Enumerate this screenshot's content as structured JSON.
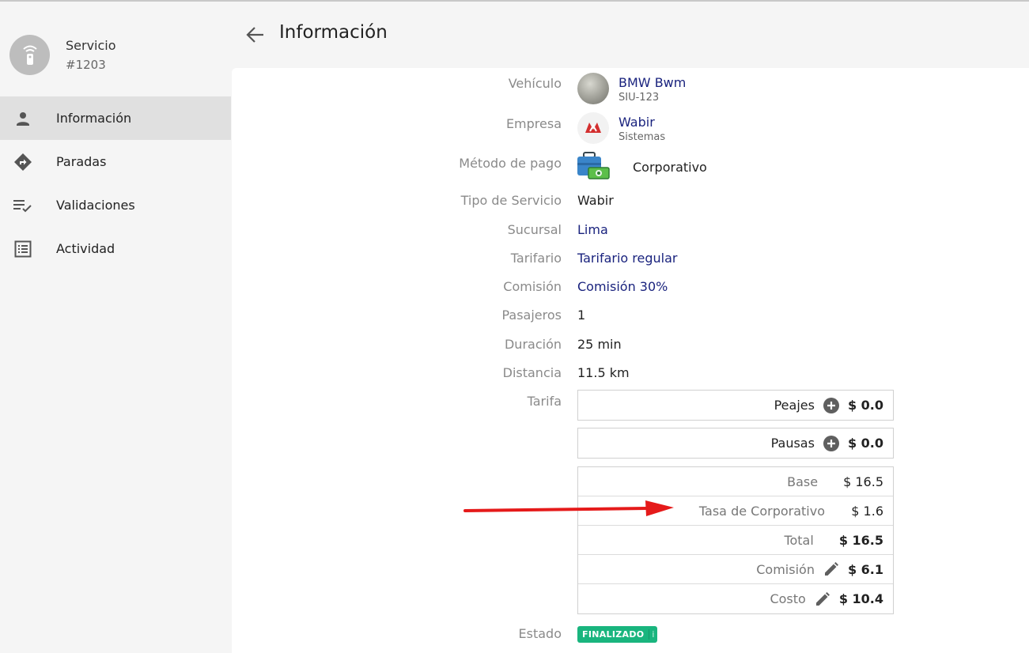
{
  "service": {
    "title": "Servicio",
    "number": "#1203"
  },
  "nav": {
    "items": [
      {
        "label": "Información",
        "icon": "person-icon",
        "active": true
      },
      {
        "label": "Paradas",
        "icon": "directions-icon",
        "active": false
      },
      {
        "label": "Validaciones",
        "icon": "playlist-check-icon",
        "active": false
      },
      {
        "label": "Actividad",
        "icon": "list-alt-icon",
        "active": false
      }
    ]
  },
  "header": {
    "title": "Información"
  },
  "fields": {
    "vehicle": {
      "label": "Vehículo",
      "name": "BMW Bwm",
      "plate": "SIU-123"
    },
    "company": {
      "label": "Empresa",
      "name": "Wabir",
      "sub": "Sistemas"
    },
    "payment": {
      "label": "Método de pago",
      "value": "Corporativo"
    },
    "service_type": {
      "label": "Tipo de Servicio",
      "value": "Wabir"
    },
    "branch": {
      "label": "Sucursal",
      "value": "Lima"
    },
    "tariff_plan": {
      "label": "Tarifario",
      "value": "Tarifario regular"
    },
    "commission": {
      "label": "Comisión",
      "value": "Comisión 30%"
    },
    "passengers": {
      "label": "Pasajeros",
      "value": "1"
    },
    "duration": {
      "label": "Duración",
      "value": "25 min"
    },
    "distance": {
      "label": "Distancia",
      "value": "11.5 km"
    },
    "fare": {
      "label": "Tarifa"
    },
    "status": {
      "label": "Estado",
      "value": "FINALIZADO",
      "info": "i"
    }
  },
  "fare": {
    "tolls": {
      "label": "Peajes",
      "amount": "$ 0.0"
    },
    "pauses": {
      "label": "Pausas",
      "amount": "$ 0.0"
    },
    "base": {
      "label": "Base",
      "amount": "$ 16.5"
    },
    "corporate_fee": {
      "label": "Tasa de Corporativo",
      "amount": "$ 1.6"
    },
    "total": {
      "label": "Total",
      "amount": "$ 16.5"
    },
    "commission": {
      "label": "Comisión",
      "amount": "$ 6.1"
    },
    "cost": {
      "label": "Costo",
      "amount": "$ 10.4"
    }
  },
  "colors": {
    "link": "#1a237e",
    "status_badge": "#19b57e",
    "annotation_arrow": "#e51a1a",
    "active_nav": "#e0e0e0"
  }
}
